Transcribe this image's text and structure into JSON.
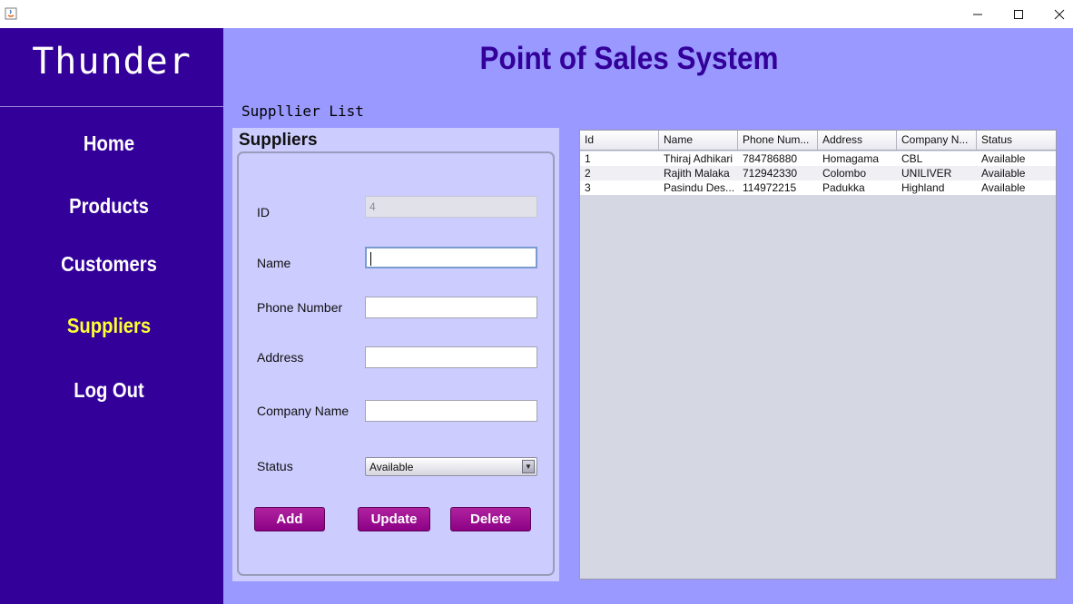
{
  "window": {
    "controls": [
      "minimize",
      "maximize",
      "close"
    ]
  },
  "sidebar": {
    "brand": "Thunder",
    "items": [
      {
        "label": "Home",
        "active": false
      },
      {
        "label": "Products",
        "active": false
      },
      {
        "label": "Customers",
        "active": false
      },
      {
        "label": "Suppliers",
        "active": true
      },
      {
        "label": "Log Out",
        "active": false
      }
    ]
  },
  "header": {
    "title": "Point of Sales System"
  },
  "main": {
    "section_label": "Suppllier List"
  },
  "form": {
    "title": "Suppliers",
    "id_label": "ID",
    "id_value": "4",
    "name_label": "Name",
    "name_value": "",
    "phone_label": "Phone Number",
    "phone_value": "",
    "address_label": "Address",
    "address_value": "",
    "company_label": "Company Name",
    "company_value": "",
    "status_label": "Status",
    "status_value": "Available",
    "add_label": "Add",
    "update_label": "Update",
    "delete_label": "Delete"
  },
  "table": {
    "columns": [
      "Id",
      "Name",
      "Phone Num...",
      "Address",
      "Company N...",
      "Status"
    ],
    "rows": [
      [
        "1",
        "Thiraj Adhikari",
        "784786880",
        "Homagama",
        "CBL",
        "Available"
      ],
      [
        "2",
        "Rajith Malaka",
        "712942330",
        "Colombo",
        "UNILIVER",
        "Available"
      ],
      [
        "3",
        "Pasindu Des...",
        "114972215",
        "Padukka",
        "Highland",
        "Available"
      ]
    ]
  },
  "colors": {
    "sidebar_bg": "#330099",
    "main_bg": "#9999ff",
    "panel_bg": "#ccccff",
    "active_nav": "#ffff33",
    "button_bg": "#8c0085"
  }
}
